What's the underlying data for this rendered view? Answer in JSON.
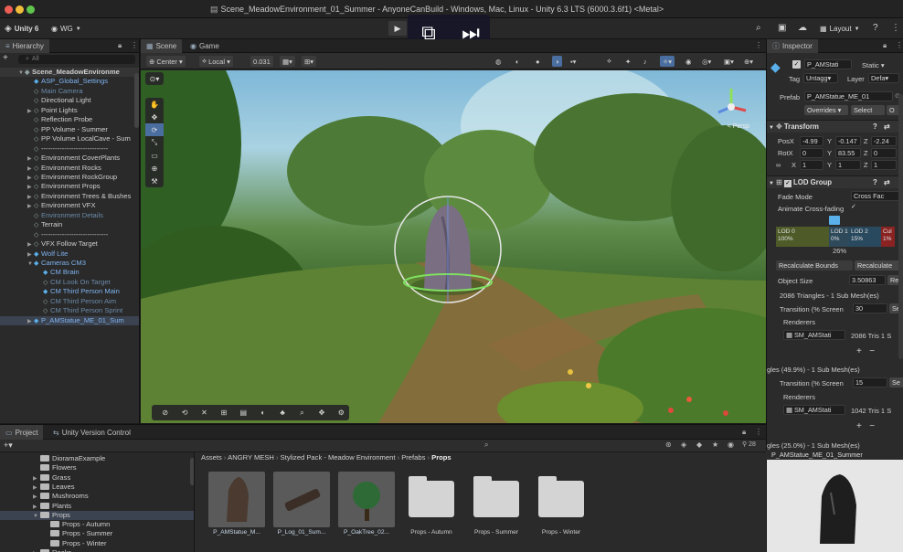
{
  "window": {
    "title": "Scene_MeadowEnvironment_01_Summer - AnyoneCanBuild - Windows, Mac, Linux - Unity 6.3 LTS (6000.3.6f1) <Metal>"
  },
  "toolbar": {
    "unity_label": "Unity 6",
    "account_label": "WG",
    "layout_label": "Layout"
  },
  "hierarchy": {
    "tab_label": "Hierarchy",
    "search_placeholder": "All",
    "rows": [
      {
        "label": "Scene_MeadowEnvironme",
        "indent": 1,
        "style": "scene"
      },
      {
        "label": "ASP_Global_Settings",
        "indent": 2,
        "style": "blue"
      },
      {
        "label": "Main Camera",
        "indent": 2,
        "style": "dim"
      },
      {
        "label": "Directional Light",
        "indent": 2,
        "style": ""
      },
      {
        "label": "Point Lights",
        "indent": 2,
        "style": "",
        "arrow": true
      },
      {
        "label": "Reflection Probe",
        "indent": 2,
        "style": ""
      },
      {
        "label": "PP Volume - Summer",
        "indent": 2,
        "style": ""
      },
      {
        "label": "PP Volume LocalCave - Sum",
        "indent": 2,
        "style": ""
      },
      {
        "label": "-----------------------------",
        "indent": 2,
        "style": ""
      },
      {
        "label": "Environment CoverPlants",
        "indent": 2,
        "style": "",
        "arrow": true
      },
      {
        "label": "Environment Rocks",
        "indent": 2,
        "style": "",
        "arrow": true
      },
      {
        "label": "Environment RockGroup",
        "indent": 2,
        "style": "",
        "arrow": true
      },
      {
        "label": "Environment Props",
        "indent": 2,
        "style": "",
        "arrow": true
      },
      {
        "label": "Environment Trees & Bushes",
        "indent": 2,
        "style": "",
        "arrow": true
      },
      {
        "label": "Environment VFX",
        "indent": 2,
        "style": "",
        "arrow": true
      },
      {
        "label": "Environment Details",
        "indent": 2,
        "style": "dim"
      },
      {
        "label": "Terrain",
        "indent": 2,
        "style": ""
      },
      {
        "label": "-----------------------------",
        "indent": 2,
        "style": ""
      },
      {
        "label": "VFX Follow Target",
        "indent": 2,
        "style": "",
        "arrow": true
      },
      {
        "label": "Wolf Lite",
        "indent": 2,
        "style": "blue",
        "arrow": true
      },
      {
        "label": "Cameras CM3",
        "indent": 2,
        "style": "blue",
        "arrow": true
      },
      {
        "label": "CM Brain",
        "indent": 3,
        "style": "blue"
      },
      {
        "label": "CM Look On Target",
        "indent": 3,
        "style": "dim"
      },
      {
        "label": "CM Third Person Main",
        "indent": 3,
        "style": "blue"
      },
      {
        "label": "CM Third Person Aim",
        "indent": 3,
        "style": "dim"
      },
      {
        "label": "CM Third Person Sprint",
        "indent": 3,
        "style": "dim"
      },
      {
        "label": "P_AMStatue_ME_01_Sum",
        "indent": 2,
        "style": "blue sel",
        "arrow": true
      }
    ]
  },
  "scene": {
    "tabs": [
      {
        "label": "Scene"
      },
      {
        "label": "Game"
      }
    ],
    "pivot_label": "Center",
    "space_label": "Local",
    "grid_value": "0.031",
    "gizmo_label": "< Persp"
  },
  "inspector": {
    "tab_label": "Inspector",
    "object_name": "P_AMStati",
    "static_label": "Static",
    "tag_label": "Tag",
    "tag_value": "Untagg",
    "layer_label": "Layer",
    "layer_value": "Defa",
    "prefab_label": "Prefab",
    "prefab_value": "P_AMStatue_ME_01",
    "overrides_label": "Overrides",
    "select_label": "Select",
    "open_label": "O",
    "transform": {
      "title": "Transform",
      "pos": {
        "label": "PosX",
        "x": "-4.99",
        "y_label": "Y",
        "y": "-0.147",
        "z_label": "Z",
        "z": "-2.24"
      },
      "rot": {
        "label": "RotX",
        "x": "0",
        "y_label": "Y",
        "y": "83.55",
        "z_label": "Z",
        "z": "0"
      },
      "scale": {
        "label": "X",
        "x": "1",
        "y_label": "Y",
        "y": "1",
        "z_label": "Z",
        "z": "1"
      }
    },
    "lod": {
      "title": "LOD Group",
      "fade_label": "Fade Mode",
      "fade_value": "Cross Fac",
      "animate_label": "Animate Cross-fading",
      "seg0_name": "LOD 0",
      "seg0_pct": "100%",
      "seg1_name": "LOD 1",
      "seg1_pct": "0%",
      "seg2_name": "LOD 2",
      "seg2_pct": "15%",
      "seg3_name": "Cul",
      "seg3_pct": "1%",
      "marker_pct": "26%",
      "recalc_bounds": "Recalculate Bounds",
      "recalc": "Recalculate",
      "object_size_label": "Object Size",
      "object_size_value": "3.50863",
      "re_label": "Re",
      "tris_info_1": "2086 Triangles - 1 Sub Mesh(es)",
      "transition_label": "Transition (% Screen",
      "transition_1": "30",
      "renderers_label": "Renderers",
      "renderer_1": "SM_AMStati",
      "renderer_1_tris": "2086 Tris 1 S",
      "tris_info_2": "gles (49.9%) - 1 Sub Mesh(es)",
      "transition_2": "15",
      "renderer_2": "SM_AMStati",
      "renderer_2_tris": "1042 Tris 1 S",
      "tris_info_3": "gles (25.0%) - 1 Sub Mesh(es)",
      "se_label": "Se"
    },
    "preview_title": "P_AMStatue_ME_01_Summer"
  },
  "project": {
    "tabs": [
      {
        "label": "Project"
      },
      {
        "label": "Unity Version Control"
      }
    ],
    "badge_count": "28",
    "tree": [
      {
        "label": "DioramaExample",
        "indent": 3
      },
      {
        "label": "Flowers",
        "indent": 3
      },
      {
        "label": "Grass",
        "indent": 3,
        "arrow": true
      },
      {
        "label": "Leaves",
        "indent": 3,
        "arrow": true
      },
      {
        "label": "Mushrooms",
        "indent": 3,
        "arrow": true
      },
      {
        "label": "Plants",
        "indent": 3,
        "arrow": true
      },
      {
        "label": "Props",
        "indent": 3,
        "arrow": true,
        "sel": true
      },
      {
        "label": "Props - Autumn",
        "indent": 4
      },
      {
        "label": "Props - Summer",
        "indent": 4
      },
      {
        "label": "Props - Winter",
        "indent": 4
      },
      {
        "label": "Rocks",
        "indent": 3,
        "arrow": true
      }
    ],
    "breadcrumbs": [
      "Assets",
      "ANGRY MESH",
      "Stylized Pack - Meadow Environment",
      "Prefabs",
      "Props"
    ],
    "assets": [
      {
        "label": "P_AMStatue_M...",
        "kind": "statue"
      },
      {
        "label": "P_Log_01_Sum...",
        "kind": "log"
      },
      {
        "label": "P_OakTree_02...",
        "kind": "tree"
      },
      {
        "label": "Props - Autumn",
        "kind": "folder"
      },
      {
        "label": "Props - Summer",
        "kind": "folder"
      },
      {
        "label": "Props - Winter",
        "kind": "folder"
      }
    ]
  },
  "colors": {
    "accent": "#4a6ea0",
    "prefab_blue": "#7fb2ee",
    "selection": "#3b4350"
  }
}
